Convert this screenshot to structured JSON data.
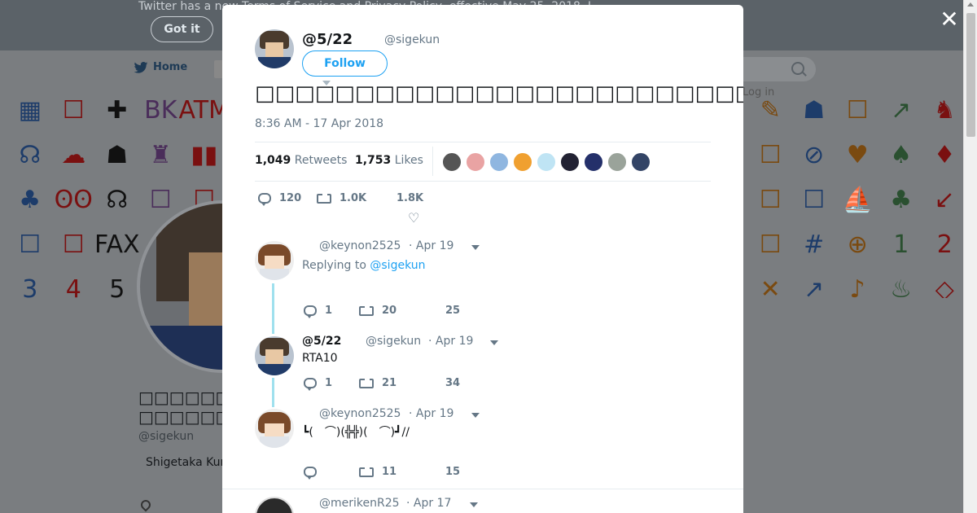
{
  "banner": {
    "text": "Twitter has a new Terms of Service and Privacy Policy, effective May 25, 2018. L",
    "button_label": "Got it"
  },
  "nav": {
    "home_label": "Home",
    "login_label": "Log in"
  },
  "background_profile": {
    "name": "□□□□□□□□□□□□",
    "handle": "@sigekun",
    "bio": "Shigetaka Kur"
  },
  "emoji_rows": [
    [
      "▦",
      "☐",
      "✚",
      "BK",
      "ATM",
      "",
      "",
      "",
      "",
      "",
      "",
      "",
      "",
      "",
      "",
      "",
      "",
      "✎",
      "☗",
      "☐",
      "↗",
      "♞"
    ],
    [
      "☊",
      "☁",
      "☗",
      "♜",
      "▮▮",
      "",
      "",
      "",
      "",
      "",
      "",
      "",
      "",
      "",
      "",
      "",
      "",
      "☐",
      "⊘",
      "♥",
      "♠",
      "♦"
    ],
    [
      "♣",
      "ʘʘ",
      "☊",
      "☐",
      "☐",
      "",
      "",
      "",
      "",
      "",
      "",
      "",
      "",
      "",
      "",
      "",
      "",
      "☐",
      "☐",
      "⛵",
      "♣",
      "↙"
    ],
    [
      "☐",
      "☐",
      "FAX",
      "",
      "",
      "",
      "",
      "",
      "",
      "",
      "",
      "",
      "",
      "",
      "",
      "",
      "",
      "☐",
      "#",
      "⊕",
      "1",
      "2"
    ],
    [
      "3",
      "4",
      "5",
      "",
      "",
      "",
      "",
      "",
      "",
      "",
      "",
      "",
      "",
      "",
      "",
      "",
      "",
      "✕",
      "↗",
      "♪",
      "♨",
      "◇"
    ]
  ],
  "modal": {
    "author_name": "@5/22",
    "author_handle": "@sigekun",
    "follow_label": "Follow",
    "tweet_text": "□□□□□□□□□□□□□□□□□□□□□□□□□□□□□□□□□□□□□□□□□□□□□",
    "timestamp": "8:36 AM - 17 Apr 2018",
    "retweets_count": "1,049",
    "retweets_label": "Retweets",
    "likes_count": "1,753",
    "likes_label": "Likes",
    "liker_colors": [
      "#555555",
      "#e9a3a3",
      "#8fb6e0",
      "#f0a030",
      "#bfe4f4",
      "#222233",
      "#24306a",
      "#9aa39a",
      "#334466"
    ],
    "actions": {
      "replies": "120",
      "retweets": "1.0K",
      "likes": "1.8K"
    }
  },
  "replies": [
    {
      "handle": "@keynon2525",
      "date": "· Apr 19",
      "replying_prefix": "Replying to",
      "replying_to": "@sigekun",
      "counts": {
        "replies": "1",
        "retweets": "20",
        "likes": "25"
      }
    },
    {
      "name": "@5/22",
      "handle": "@sigekun",
      "date": "· Apr 19",
      "text": "RTA10",
      "counts": {
        "replies": "1",
        "retweets": "21",
        "likes": "34"
      }
    },
    {
      "handle": "@keynon2525",
      "date": "· Apr 19",
      "text": "┗(　⌒)(╬╬)(　⌒)┛//",
      "counts": {
        "replies": "",
        "retweets": "11",
        "likes": "15"
      }
    },
    {
      "handle": "@merikenR25",
      "date": "· Apr 17"
    }
  ],
  "close_label": "✕"
}
